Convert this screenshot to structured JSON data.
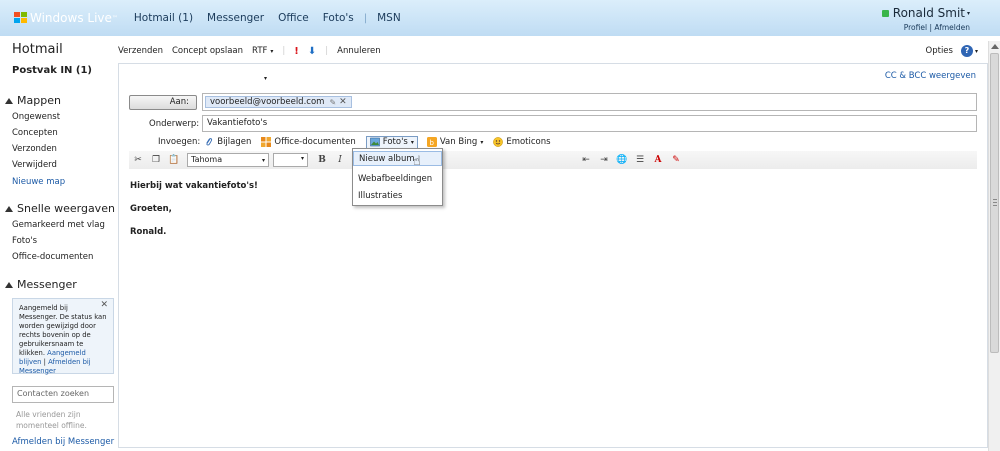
{
  "header": {
    "brand": "Windows Live",
    "brand_mark": "™",
    "nav": [
      "Hotmail (1)",
      "Messenger",
      "Office",
      "Foto's",
      "MSN"
    ],
    "separator": "|",
    "user_name": "Ronald Smit",
    "profile_link": "Profiel",
    "link_separator": "|",
    "logout_link": "Afmelden",
    "status_color": "#39b54a"
  },
  "sidebar": {
    "app_title": "Hotmail",
    "inbox": "Postvak IN (1)",
    "folders_head": "Mappen",
    "folders": [
      "Ongewenst",
      "Concepten",
      "Verzonden",
      "Verwijderd"
    ],
    "new_folder": "Nieuwe map",
    "quick_head": "Snelle weergaven",
    "quick": [
      "Gemarkeerd met vlag",
      "Foto's",
      "Office-documenten"
    ],
    "messenger_head": "Messenger",
    "messenger_box": {
      "text": "Aangemeld bij Messenger. De status kan worden gewijzigd door rechts bovenin op de gebruikersnaam te klikken.",
      "stay_link": "Aangemeld blijven",
      "separator": "|",
      "logout_link": "Afmelden bij Messenger"
    },
    "contact_search_placeholder": "Contacten zoeken",
    "offline_text": "Alle vrienden zijn momenteel offline.",
    "logout_messenger": "Afmelden bij Messenger"
  },
  "toolbar": {
    "send": "Verzenden",
    "save_draft": "Concept opslaan",
    "rtf": "RTF",
    "cancel": "Annuleren",
    "options": "Opties",
    "help": "?"
  },
  "compose": {
    "cc_bcc": "CC & BCC weergeven",
    "to_label": "Aan:",
    "recipient": "voorbeeld@voorbeeld.com",
    "subject_label": "Onderwerp:",
    "subject_value": "Vakantiefoto's",
    "insert_label": "Invoegen:",
    "insert_items": [
      "Bijlagen",
      "Office-documenten",
      "Foto's",
      "Van Bing",
      "Emoticons"
    ],
    "font_name": "Tahoma",
    "body_lines": [
      "Hierbij wat vakantiefoto's!",
      "",
      "Groeten,",
      "",
      "Ronald."
    ]
  },
  "photos_menu": [
    "Nieuw album",
    "Webafbeeldingen",
    "Illustraties"
  ],
  "colors": {
    "accent": "#1c5aa6",
    "header_bg": "#cfe6f8",
    "flag": "#d9141a"
  }
}
